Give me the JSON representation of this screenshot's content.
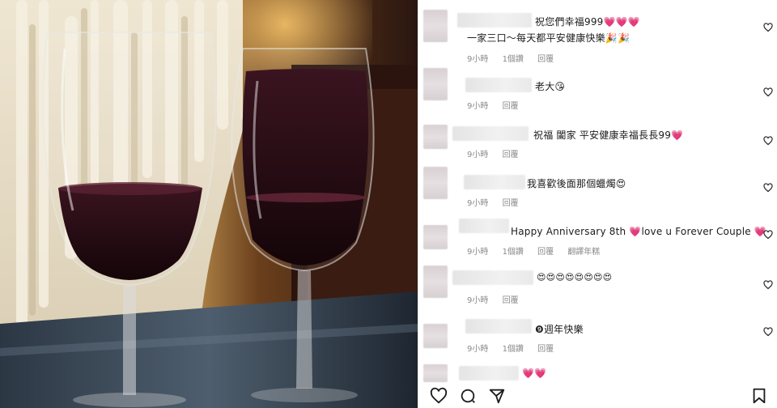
{
  "comments": [
    {
      "text": "祝您們幸福999💗💗💗",
      "text2": "一家三口～每天都平安健康快樂🎉🎉",
      "time": "9小時",
      "likes": "1個讚",
      "reply": "回覆",
      "extra": ""
    },
    {
      "text": "老大😘",
      "text2": "",
      "time": "9小時",
      "likes": "",
      "reply": "回覆",
      "extra": ""
    },
    {
      "text": "祝福 闔家 平安健康幸福長長99💗",
      "text2": "",
      "time": "9小時",
      "likes": "",
      "reply": "回覆",
      "extra": ""
    },
    {
      "text": "我喜歡後面那個蠟燭😍",
      "text2": "",
      "time": "9小時",
      "likes": "",
      "reply": "回覆",
      "extra": ""
    },
    {
      "text": "Happy Anniversary 8th 💗love u Forever Couple 💗",
      "text2": "",
      "time": "9小時",
      "likes": "1個讚",
      "reply": "回覆",
      "extra": "翻譯年糕"
    },
    {
      "text": "😍😍😍😍😍😍😍😍",
      "text2": "",
      "time": "9小時",
      "likes": "",
      "reply": "回覆",
      "extra": ""
    },
    {
      "text": "❾週年快樂",
      "text2": "",
      "time": "9小時",
      "likes": "1個讚",
      "reply": "回覆",
      "extra": ""
    },
    {
      "text": "💗💗",
      "text2": "",
      "time": "",
      "likes": "",
      "reply": "",
      "extra": ""
    }
  ],
  "icons": {
    "like": "heart-outline-icon",
    "comment": "comment-bubble-icon",
    "share": "paper-plane-icon",
    "save": "bookmark-icon"
  },
  "colors": {
    "heart": "#e0245e",
    "meta": "#8a8a8a"
  }
}
